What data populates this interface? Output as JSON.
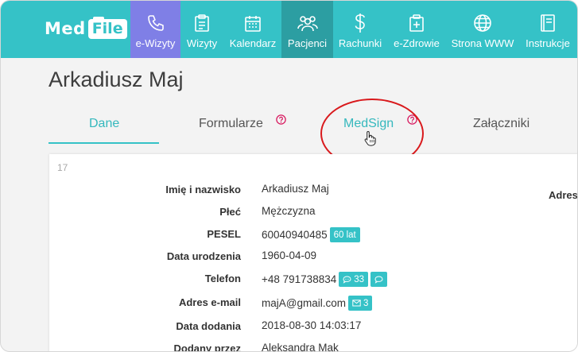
{
  "nav": {
    "logo_med": "Med",
    "logo_file": "File",
    "items": [
      {
        "label": "e-Wizyty",
        "icon": "phone-icon"
      },
      {
        "label": "Wizyty",
        "icon": "clipboard-icon"
      },
      {
        "label": "Kalendarz",
        "icon": "calendar-icon"
      },
      {
        "label": "Pacjenci",
        "icon": "users-icon"
      },
      {
        "label": "Rachunki",
        "icon": "dollar-icon"
      },
      {
        "label": "e-Zdrowie",
        "icon": "medical-kit-icon"
      },
      {
        "label": "Strona WWW",
        "icon": "globe-icon"
      },
      {
        "label": "Instrukcje",
        "icon": "book-icon"
      }
    ],
    "colors": {
      "bar": "#35c2c7",
      "active_purple": "#7f7fe6",
      "active_dark": "#2c9ea2"
    }
  },
  "patient": {
    "name": "Arkadiusz Maj"
  },
  "tabs": [
    {
      "label": "Dane"
    },
    {
      "label": "Formularze"
    },
    {
      "label": "MedSign"
    },
    {
      "label": "Załączniki"
    }
  ],
  "card": {
    "id": "17",
    "fields": [
      {
        "label": "Imię i nazwisko",
        "value": "Arkadiusz Maj"
      },
      {
        "label": "Płeć",
        "value": "Mężczyzna"
      },
      {
        "label": "PESEL",
        "value": "60040940485",
        "badge": "60 lat"
      },
      {
        "label": "Data urodzenia",
        "value": "1960-04-09"
      },
      {
        "label": "Telefon",
        "value": "+48 791738834",
        "badge": "33"
      },
      {
        "label": "Adres e-mail",
        "value": "majA@gmail.com",
        "badge": "3"
      },
      {
        "label": "Data dodania",
        "value": "2018-08-30 14:03:17"
      },
      {
        "label": "Dodany przez",
        "value": "Aleksandra Mak"
      }
    ],
    "right_label": "Adres"
  }
}
